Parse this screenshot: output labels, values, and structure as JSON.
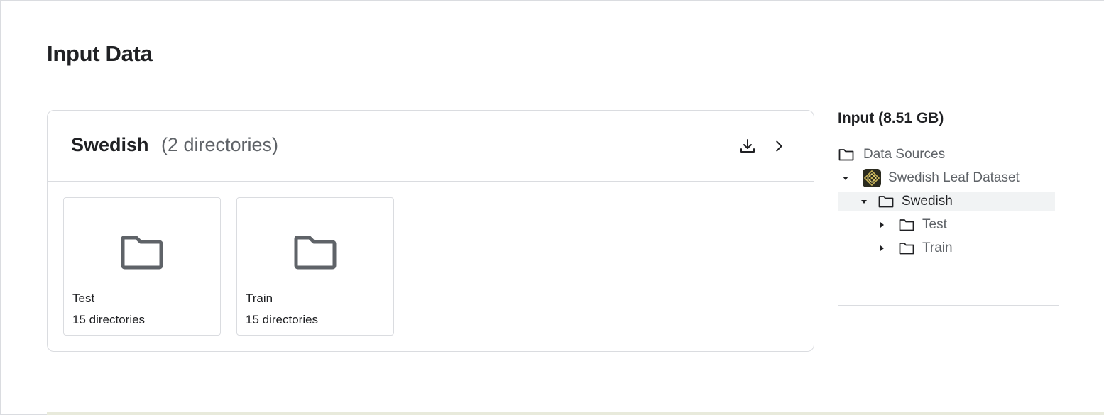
{
  "page": {
    "title": "Input Data"
  },
  "card": {
    "title": "Swedish",
    "count": "(2 directories)",
    "tiles": [
      {
        "name": "Test",
        "meta": "15 directories"
      },
      {
        "name": "Train",
        "meta": "15 directories"
      }
    ]
  },
  "side": {
    "title": "Input (8.51 GB)",
    "tree": {
      "data_sources": "Data Sources",
      "dataset": "Swedish Leaf Dataset",
      "swedish": "Swedish",
      "test": "Test",
      "train": "Train"
    }
  },
  "colors": {
    "icon": "#5f6368",
    "border": "#dadce0",
    "selected_bg": "#f1f3f4"
  }
}
